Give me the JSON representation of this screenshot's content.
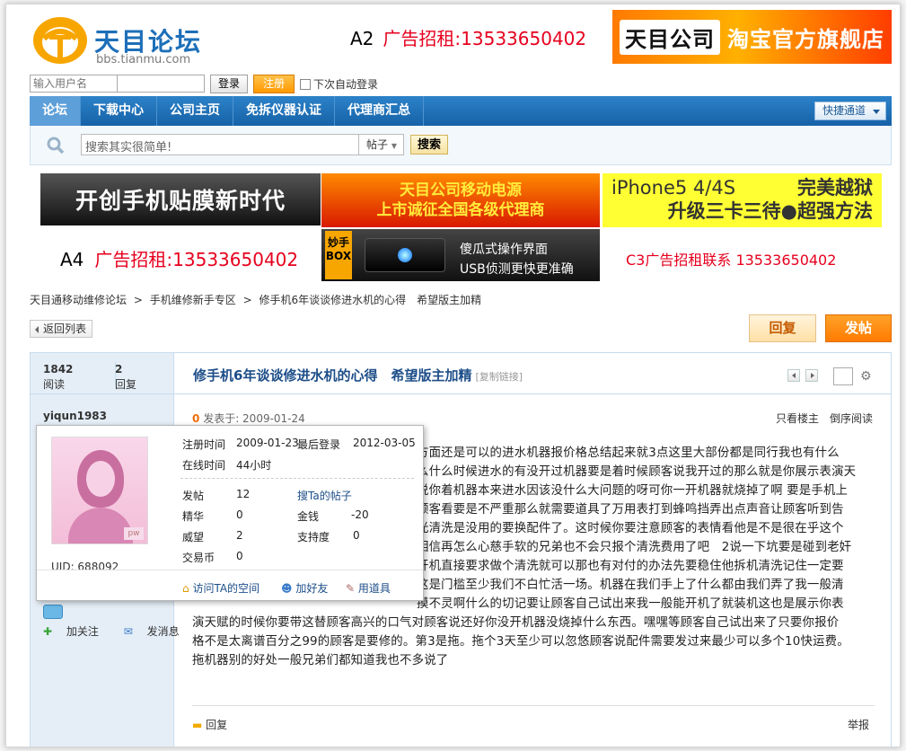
{
  "header": {
    "logo_text": "天目论坛",
    "logo_url": "bbs.tianmu.com",
    "ad_a2_label": "A2",
    "ad_a2_text": "广告招租:13533650402",
    "ad_taobao_brand": "天目公司",
    "ad_taobao_text": "淘宝官方旗舰店"
  },
  "login": {
    "username_placeholder": "输入用户名",
    "login_label": "登录",
    "register_label": "注册",
    "remember_label": "下次自动登录"
  },
  "nav": {
    "items": [
      {
        "label": "论坛"
      },
      {
        "label": "下载中心"
      },
      {
        "label": "公司主页"
      },
      {
        "label": "免拆仪器认证"
      },
      {
        "label": "代理商汇总"
      }
    ],
    "quick_label": "快捷通道"
  },
  "search": {
    "placeholder": "搜索其实很简单!",
    "type": "帖子",
    "button": "搜索"
  },
  "ads": {
    "ad1": "开创手机贴膜新时代",
    "ad2_line1": "天目公司移动电源",
    "ad2_line2": "上市诚征全国各级代理商",
    "ad3_left": "iPhone5 4/4S",
    "ad3_right": "完美越狱",
    "ad3_line2": "升级三卡三待●超强方法",
    "a4_label": "A4",
    "a4_text": "广告招租:13533650402",
    "ad5_tag": "妙手BOX",
    "ad5_line1": "傻瓜式操作界面",
    "ad5_line2": "USB侦测更快更准确",
    "c3_text": "C3广告招租联系 13533650402"
  },
  "breadcrumb": [
    "天目通移动维修论坛",
    ">",
    "手机维修新手专区",
    ">",
    "修手机6年谈谈修进水机的心得　希望版主加精"
  ],
  "back_label": "返回列表",
  "reply_label": "回复",
  "post_label": "发帖",
  "thread": {
    "views": "1842",
    "views_label": "阅读",
    "replies": "2",
    "replies_label": "回复",
    "title": "修手机6年谈谈修进水机的心得　希望版主加精",
    "copy_link": "[复制链接]",
    "author": "yiqun1983",
    "floor_num": "0",
    "posted": "发表于: 2009-01-24",
    "only_author": "只看楼主",
    "reverse": "倒序阅读",
    "body": [
      "方面还是可以的进水机器报价格总结起来就3点这里大部份都是同行我也有什么",
      "么什么时候进水的有没开过机器要是着时候顾客说我开过的那么就是你展示表演天",
      "说你着机器本来进水因该没什么大问题的呀可你一开机器就烧掉了啊 要是手机上",
      "顾客看要是不严重那么就需要道具了万用表打到蜂鸣挡弄出点声音让顾客听到告",
      "光清洗是没用的要换配件了。这时候你要注意顾客的表情看他是不是很在乎这个",
      "相信再怎么心慈手软的兄弟也不会只报个清洗费用了吧　2说一下坑要是碰到老奸",
      "开机直接要求做个清洗就可以那也有对付的办法先要稳住他拆机清洗记住一定要",
      "这是门槛至少我们不白忙活一场。机器在我们手上了什么都由我们弄了我一般清",
      "摸不灵啊什么的切记要让顾客自己试出来我一般能开机了就装机这也是展示你表",
      "演天赋的时候你要带这替顾客高兴的口气对顾客说还好你没开机器没烧掉什么东西。嘿嘿等顾客自己试出来了只要你报价",
      "格不是太离谱百分之99的顾客是要修的。第3是拖。拖个3天至少可以忽悠顾客说配件需要发过来最少可以多个10快运费。",
      "拖机器别的好处一般兄弟们都知道我也不多说了"
    ],
    "follow": "加关注",
    "message": "发消息",
    "foot_reply": "回复",
    "report": "举报"
  },
  "popup": {
    "uid": "UID: 688092",
    "reg_label": "注册时间",
    "reg_value": "2009-01-23",
    "last_label": "最后登录",
    "last_value": "2012-03-05",
    "online_label": "在线时间",
    "online_value": "44小时",
    "posts_label": "发帖",
    "posts_value": "12",
    "search_link": "搜Ta的帖子",
    "digest_label": "精华",
    "digest_value": "0",
    "money_label": "金钱",
    "money_value": "-20",
    "prestige_label": "威望",
    "prestige_value": "2",
    "support_label": "支持度",
    "support_value": "0",
    "coin_label": "交易币",
    "coin_value": "0",
    "visit": "访问TA的空间",
    "add_friend": "加好友",
    "use_item": "用道具"
  },
  "colors": {
    "nav": "#1d6fb8",
    "accent": "#ff8a00",
    "ad_red": "#e6001e"
  }
}
